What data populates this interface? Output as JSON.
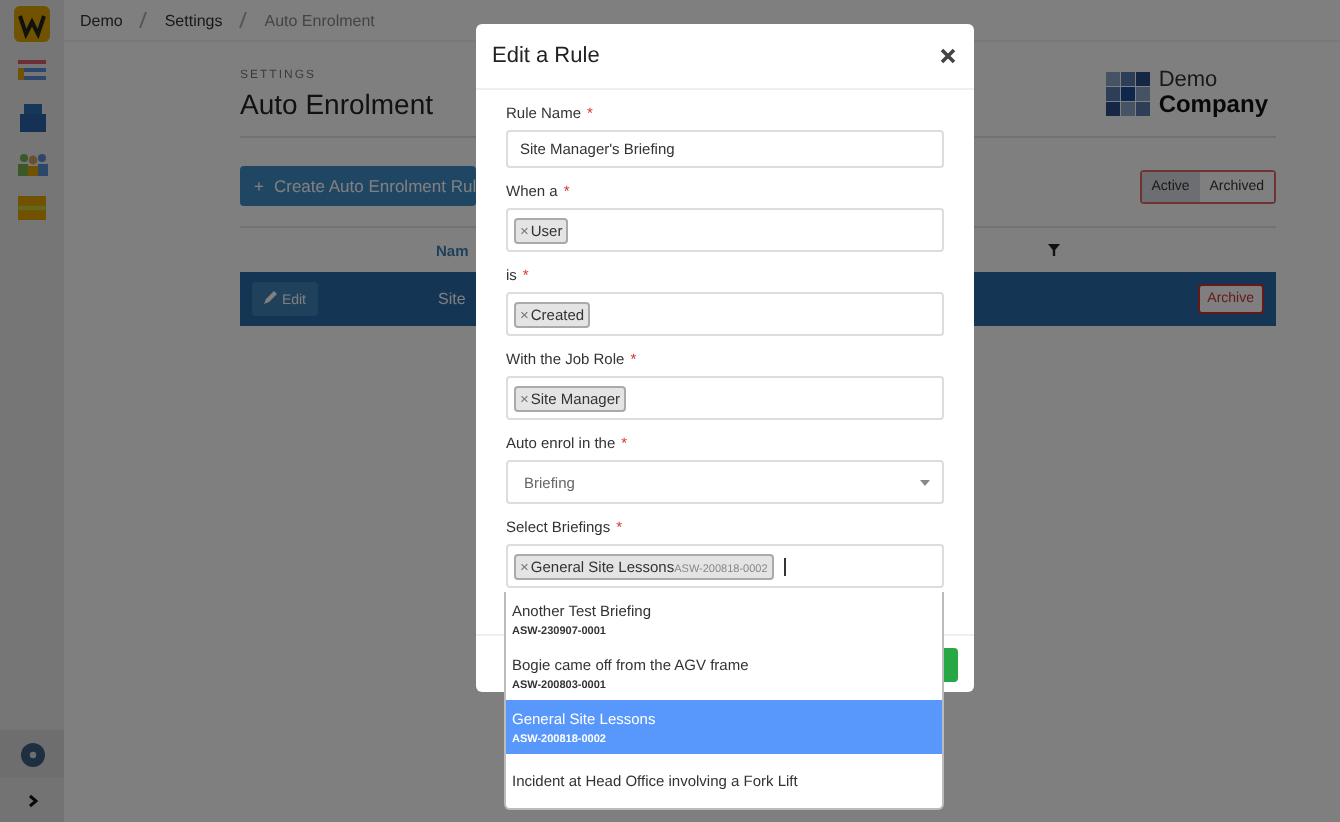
{
  "breadcrumbs": [
    {
      "label": "Demo",
      "current": false
    },
    {
      "label": "Settings",
      "current": false
    },
    {
      "label": "Auto Enrolment",
      "current": true
    }
  ],
  "page": {
    "eyebrow": "SETTINGS",
    "title": "Auto Enrolment",
    "create_button_icon": "+",
    "create_button": "Create Auto Enrolment Rul",
    "filter_tabs": [
      {
        "label": "Active",
        "selected": true
      },
      {
        "label": "Archived",
        "selected": false
      }
    ],
    "column_header": "Nam",
    "row": {
      "edit": "Edit",
      "name": "Site",
      "archive": "Archive"
    }
  },
  "logo": {
    "line1": "Demo",
    "line2": "Company"
  },
  "modal": {
    "title": "Edit a Rule",
    "fields": [
      {
        "kind": "text",
        "label": "Rule Name",
        "required_mark": "*",
        "value": "Site Manager's Briefing"
      },
      {
        "kind": "tags",
        "label": "When a",
        "required_mark": "*",
        "tags": [
          {
            "remove": "×",
            "label": "User"
          }
        ]
      },
      {
        "kind": "tags",
        "label": "is",
        "required_mark": "*",
        "tags": [
          {
            "remove": "×",
            "label": "Created"
          }
        ]
      },
      {
        "kind": "tags",
        "label": "With the Job Role",
        "required_mark": "*",
        "tags": [
          {
            "remove": "×",
            "label": "Site Manager"
          }
        ]
      },
      {
        "kind": "select",
        "label": "Auto enrol in the",
        "required_mark": "*",
        "value": "Briefing"
      },
      {
        "kind": "tags",
        "label": "Select Briefings",
        "required_mark": "*",
        "tags": [
          {
            "remove": "×",
            "label": "General Site Lessons",
            "code": "ASW-200818-0002"
          }
        ],
        "focused": true
      }
    ],
    "dropdown": [
      {
        "title": "Another Test Briefing",
        "code": "ASW-230907-0001",
        "selected": false
      },
      {
        "title": "Bogie came off from the AGV frame",
        "code": "ASW-200803-0001",
        "selected": false
      },
      {
        "title": "General Site Lessons",
        "code": "ASW-200818-0002",
        "selected": true
      },
      {
        "title": "Incident at Head Office involving a Fork Lift",
        "selected": false
      }
    ]
  }
}
